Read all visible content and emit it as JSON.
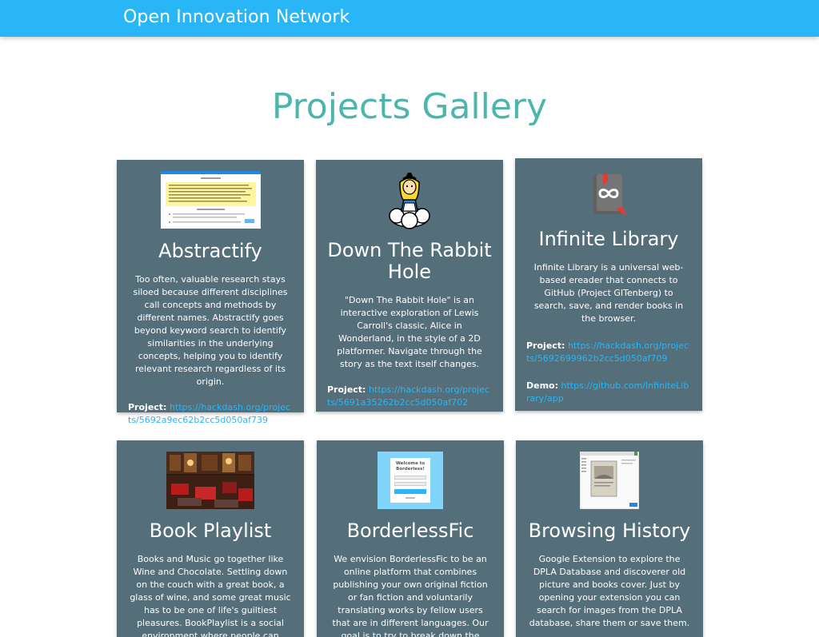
{
  "navbar": {
    "brand": "Open Innovation Network"
  },
  "page": {
    "title": "Projects Gallery"
  },
  "projects": [
    {
      "title": "Abstractify",
      "description": "Too often, valuable research stays siloed because different disciplines call concepts and methods by different names. Abstractify goes beyond keyword search to identify similarities in the underlying concepts, helping you to identify relevant research regardless of its origin.",
      "project_label": "Project:",
      "project_url": "https://hackdash.org/projects/5692a9ec62b2cc5d050af739",
      "thumbnail": "screenshot-thumbnail"
    },
    {
      "title": "Down The Rabbit Hole",
      "description": "\"Down The Rabbit Hole\" is an interactive exploration of Lewis Carroll's classic, Alice in Wonderland, in the style of a 2D platformer. Navigate through the story as the text itself changes.",
      "project_label": "Project:",
      "project_url": "https://hackdash.org/projects/5691a35262b2cc5d050af702",
      "thumbnail": "alice-icon"
    },
    {
      "title": "Infinite Library",
      "description": "Infinite Library is a universal web-based ereader that connects to GitHub (Project GITenberg) to search, save, and render books in the browser.",
      "project_label": "Project:",
      "project_url": "https://hackdash.org/projects/5692699962b2cc5d050af709",
      "demo_label": "Demo:",
      "demo_url": "https://github.com/InfiniteLibrary/app",
      "thumbnail": "infinity-book-icon"
    },
    {
      "title": "Book Playlist",
      "description": "Books and Music go together like Wine and Chocolate. Settling down on the couch with a great book, a glass of wine, and some great music has to be one of life's guiltiest pleasures. BookPlaylist is a social environment where people can create and listen to collaborative music",
      "thumbnail": "library-photo"
    },
    {
      "title": "BorderlessFic",
      "description": "We envision BorderlessFic to be an online platform that combines publishing your own original fiction or fan fiction and voluntarily translating works by fellow users that are in different languages. Our goal is to try to break down the language barrier and allow online writers to share",
      "thumbnail": "login-screen-thumbnail",
      "thumbnail_text": "Welcome to Borderless!"
    },
    {
      "title": "Browsing History",
      "description": "Google Extension to explore the DPLA Database and discoverer old picture and books cover. Just by opening your extension you can search for images from the DPLA database, share them or save them.",
      "thumbnail": "browser-screenshot-thumbnail"
    }
  ],
  "colors": {
    "navbar": "#29b6f6",
    "title": "#4db6ac",
    "card": "#546e7a",
    "link": "#29b6f6"
  }
}
